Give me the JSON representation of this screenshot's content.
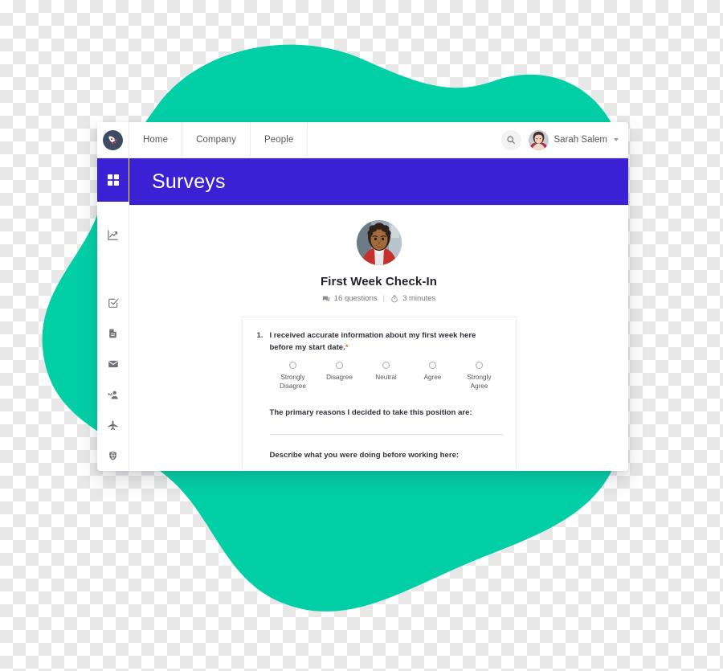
{
  "theme": {
    "blob_green": "#03cfa6",
    "header_purple": "#3c20d4",
    "accent_orange": "#ef6c2a",
    "text_dark": "#30333a",
    "text_muted": "#75787e"
  },
  "topbar": {
    "logo_icon": "rocket-icon",
    "tabs": [
      {
        "label": "Home"
      },
      {
        "label": "Company"
      },
      {
        "label": "People"
      }
    ],
    "search_icon": "search-icon",
    "user": {
      "name": "Sarah Salem",
      "avatar_icon": "user-avatar",
      "caret_icon": "chevron-down-icon"
    }
  },
  "sidebar": {
    "items": [
      {
        "icon": "dashboard-grid-icon",
        "active": true
      },
      {
        "icon": "analytics-chart-icon",
        "active": false
      },
      {
        "icon": "checkbox-task-icon",
        "active": false
      },
      {
        "icon": "document-icon",
        "active": false
      },
      {
        "icon": "mail-envelope-icon",
        "active": false
      },
      {
        "icon": "people-group-icon",
        "active": false
      },
      {
        "icon": "airplane-travel-icon",
        "active": false
      },
      {
        "icon": "shield-globe-icon",
        "active": false
      }
    ]
  },
  "page": {
    "title": "Surveys"
  },
  "survey": {
    "avatar_icon": "survey-author-avatar",
    "title": "First Week Check-In",
    "meta": {
      "questions_icon": "comment-bubble-icon",
      "questions_text": "16 questions",
      "separator": "|",
      "duration_icon": "stopwatch-icon",
      "duration_text": "3 minutes"
    },
    "questions": [
      {
        "number": "1.",
        "text": "I received accurate information about my first week here before my start date.",
        "required_marker": "*",
        "scale": [
          {
            "label": "Strongly Disagree"
          },
          {
            "label": "Disagree"
          },
          {
            "label": "Neutral"
          },
          {
            "label": "Agree"
          },
          {
            "label": "Strongly Agree"
          }
        ]
      }
    ],
    "text_fields": [
      {
        "label": "The primary reasons I decided to take this position are:",
        "value": ""
      },
      {
        "label": "Describe what you were doing before working here:",
        "value": ""
      }
    ]
  }
}
